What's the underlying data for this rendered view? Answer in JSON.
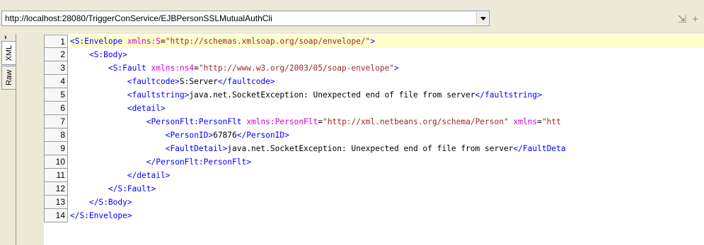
{
  "toolbar": {
    "url": "http://localhost:28080/TriggerConService/EJBPersonSSLMutualAuthCli"
  },
  "side_tabs": [
    {
      "label": "XML",
      "active": true
    },
    {
      "label": "Raw",
      "active": false
    }
  ],
  "editor": {
    "lines": [
      {
        "num": "1",
        "segments": [
          [
            "tag",
            "<S:Envelope "
          ],
          [
            "attr",
            "xmlns:S"
          ],
          [
            "sym",
            "="
          ],
          [
            "val",
            "\"http://schemas.xmlsoap.org/soap/envelope/\""
          ],
          [
            "tag",
            ">"
          ]
        ]
      },
      {
        "num": "2",
        "segments": [
          [
            "sym",
            "    "
          ],
          [
            "tag",
            "<S:Body>"
          ]
        ]
      },
      {
        "num": "3",
        "segments": [
          [
            "sym",
            "        "
          ],
          [
            "tag",
            "<S:Fault "
          ],
          [
            "attr",
            "xmlns:ns4"
          ],
          [
            "sym",
            "="
          ],
          [
            "val",
            "\"http://www.w3.org/2003/05/soap-envelope\""
          ],
          [
            "tag",
            ">"
          ]
        ]
      },
      {
        "num": "4",
        "segments": [
          [
            "sym",
            "            "
          ],
          [
            "tag",
            "<faultcode>"
          ],
          [
            "txt",
            "S:Server"
          ],
          [
            "tag",
            "</faultcode>"
          ]
        ]
      },
      {
        "num": "5",
        "segments": [
          [
            "sym",
            "            "
          ],
          [
            "tag",
            "<faultstring>"
          ],
          [
            "txt",
            "java.net.SocketException: Unexpected end of file from server"
          ],
          [
            "tag",
            "</faultstring>"
          ]
        ]
      },
      {
        "num": "6",
        "segments": [
          [
            "sym",
            "            "
          ],
          [
            "tag",
            "<detail>"
          ]
        ]
      },
      {
        "num": "7",
        "segments": [
          [
            "sym",
            "                "
          ],
          [
            "tag",
            "<PersonFlt:PersonFlt "
          ],
          [
            "attr",
            "xmlns:PersonFlt"
          ],
          [
            "sym",
            "="
          ],
          [
            "val",
            "\"http://xml.netbeans.org/schema/Person\""
          ],
          [
            "sym",
            " "
          ],
          [
            "attr",
            "xmlns"
          ],
          [
            "sym",
            "="
          ],
          [
            "val",
            "\"htt"
          ]
        ]
      },
      {
        "num": "8",
        "segments": [
          [
            "sym",
            "                    "
          ],
          [
            "tag",
            "<PersonID>"
          ],
          [
            "txt",
            "67876"
          ],
          [
            "tag",
            "</PersonID>"
          ]
        ]
      },
      {
        "num": "9",
        "segments": [
          [
            "sym",
            "                    "
          ],
          [
            "tag",
            "<FaultDetail>"
          ],
          [
            "txt",
            "java.net.SocketException: Unexpected end of file from server"
          ],
          [
            "tag",
            "</FaultDeta"
          ]
        ]
      },
      {
        "num": "10",
        "segments": [
          [
            "sym",
            "                "
          ],
          [
            "tag",
            "</PersonFlt:PersonFlt>"
          ]
        ]
      },
      {
        "num": "11",
        "segments": [
          [
            "sym",
            "            "
          ],
          [
            "tag",
            "</detail>"
          ]
        ]
      },
      {
        "num": "12",
        "segments": [
          [
            "sym",
            "        "
          ],
          [
            "tag",
            "</S:Fault>"
          ]
        ]
      },
      {
        "num": "13",
        "segments": [
          [
            "sym",
            "    "
          ],
          [
            "tag",
            "</S:Body>"
          ]
        ]
      },
      {
        "num": "14",
        "segments": [
          [
            "tag",
            "</S:Envelope>"
          ]
        ]
      }
    ]
  },
  "colors": {
    "tag": "#0000ff",
    "attr": "#d000d0",
    "value": "#9a2a2a",
    "highlight": "#ffffcc"
  }
}
